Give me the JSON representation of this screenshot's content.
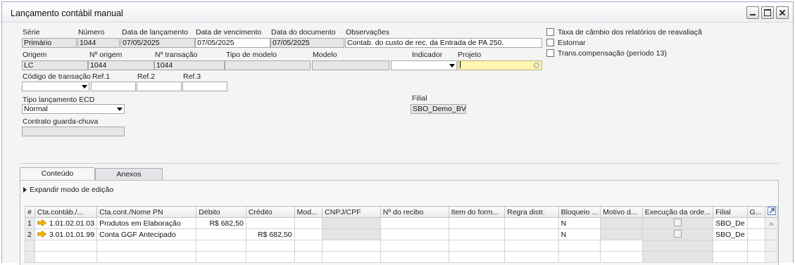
{
  "window": {
    "title": "Lançamento contábil manual"
  },
  "header": {
    "serie": {
      "label": "Série",
      "value": "Primário"
    },
    "numero": {
      "label": "Número",
      "value": "1044"
    },
    "data_lancamento": {
      "label": "Data de lançamento",
      "value": "07/05/2025"
    },
    "data_vencimento": {
      "label": "Data de vencimento",
      "value": "07/05/2025"
    },
    "data_documento": {
      "label": "Data do documento",
      "value": "07/05/2025"
    },
    "observacoes": {
      "label": "Observações",
      "value": "Contab. do custo de rec. da Entrada de PA 250."
    },
    "origem": {
      "label": "Origem",
      "value": "LC"
    },
    "n_origem": {
      "label": "Nº origem",
      "value": "1044"
    },
    "n_transacao": {
      "label": "Nº transação",
      "value": "1044"
    },
    "tipo_modelo": {
      "label": "Tipo de modelo",
      "value": ""
    },
    "modelo": {
      "label": "Modelo",
      "value": ""
    },
    "indicador": {
      "label": "Indicador",
      "value": ""
    },
    "projeto": {
      "label": "Projeto",
      "value": ""
    },
    "codigo_transacao": {
      "label": "Código de transação",
      "value": ""
    },
    "ref1": {
      "label": "Ref.1",
      "value": ""
    },
    "ref2": {
      "label": "Ref.2",
      "value": ""
    },
    "ref3": {
      "label": "Ref.3",
      "value": ""
    },
    "tipo_lancamento_ecd": {
      "label": "Tipo lançamento ECD",
      "value": "Normal"
    },
    "contrato": {
      "label": "Contrato guarda-chuva",
      "value": ""
    },
    "filial": {
      "label": "Filial",
      "value": "SBO_Demo_BV"
    }
  },
  "options": {
    "taxa_cambio": {
      "label": "Taxa de câmbio dos relatórios de reavaliaçã",
      "checked": false
    },
    "estornar": {
      "label": "Estornar",
      "checked": false
    },
    "trans_compensacao": {
      "label": "Trans.compensação (período 13)",
      "checked": false
    }
  },
  "tabs": [
    {
      "label": "Conteúdo",
      "active": true
    },
    {
      "label": "Anexos",
      "active": false
    }
  ],
  "expand_label": "Expandir modo de edição",
  "grid": {
    "columns": [
      "#",
      "Cta.contáb./...",
      "Cta.cont./Nome PN",
      "Débito",
      "Crédito",
      "Mod...",
      "CNPJ/CPF",
      "Nº do recibo",
      "Item do form...",
      "Regra distr.",
      "Bloqueio ...",
      "Motivo d...",
      "Execução da orde...",
      "Filial",
      "G..."
    ],
    "rows": [
      {
        "num": "1",
        "conta": "1.01.02.01.03",
        "nome": "Produtos em Elaboração",
        "debito": "R$ 682,50",
        "credito": "",
        "bloqueio": "N",
        "filial": "SBO_De"
      },
      {
        "num": "2",
        "conta": "3.01.01.01.99",
        "nome": "Conta GGF Antecipado",
        "debito": "",
        "credito": "R$ 682,50",
        "bloqueio": "N",
        "filial": "SBO_De"
      }
    ]
  },
  "colors": {
    "arrow_icon": "#f2b600",
    "highlight_field": "#fff6b0"
  }
}
